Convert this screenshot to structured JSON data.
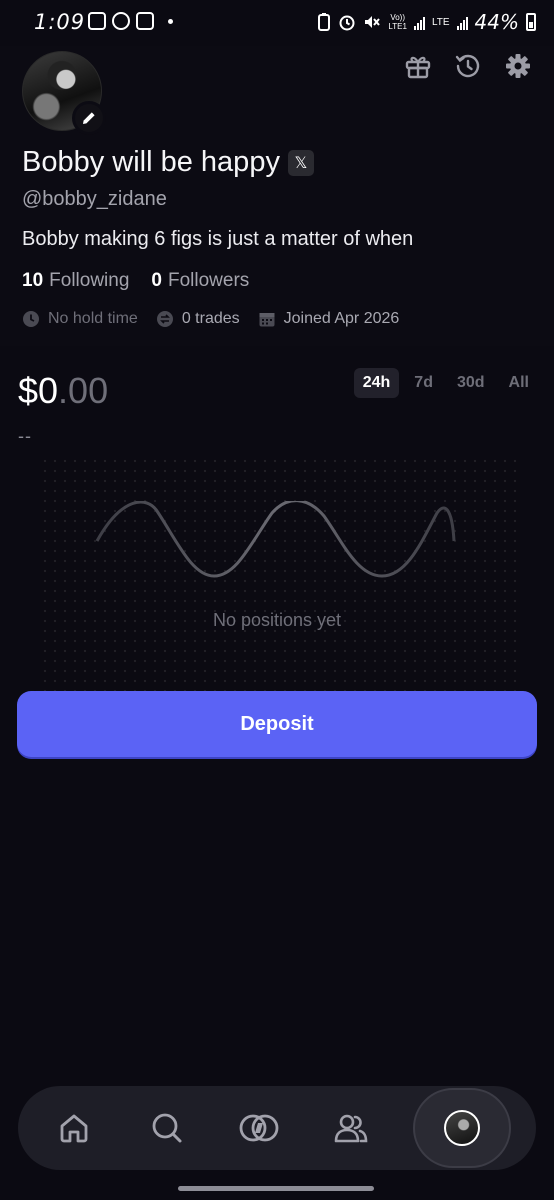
{
  "status_bar": {
    "time": "1:09",
    "battery": "44%",
    "volte": "Vo))",
    "lte1": "LTE1",
    "lte": "LTE"
  },
  "profile": {
    "display_name": "Bobby will be happy",
    "x_badge": "𝕏",
    "handle": "@bobby_zidane",
    "bio": "Bobby making 6 figs is just a matter of when",
    "following_count": "10",
    "following_label": "Following",
    "followers_count": "0",
    "followers_label": "Followers",
    "hold_time": "No hold time",
    "trades": "0 trades",
    "joined": "Joined Apr 2026"
  },
  "portfolio": {
    "balance_main": "$0",
    "balance_cents": ".00",
    "change": "--",
    "ranges": [
      "24h",
      "7d",
      "30d",
      "All"
    ],
    "active_range": "24h",
    "empty_text": "No positions yet",
    "deposit_label": "Deposit"
  },
  "nav": {
    "items": [
      "home-icon",
      "search-icon",
      "trade-icon",
      "social-icon",
      "profile-avatar"
    ],
    "active": "profile-avatar"
  },
  "colors": {
    "background": "#0b0a12",
    "accent": "#5b63f5",
    "muted": "#6f6f79"
  }
}
